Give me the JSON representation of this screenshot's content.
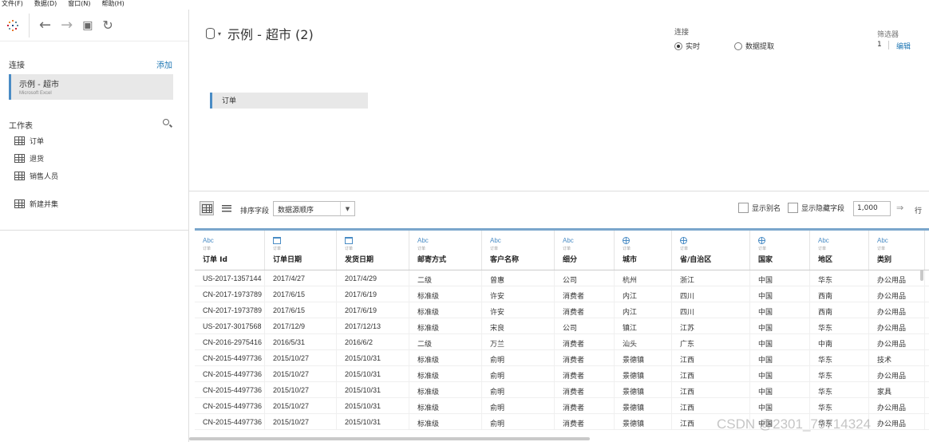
{
  "menu": [
    "文件(F)",
    "数据(D)",
    "窗口(N)",
    "帮助(H)"
  ],
  "left": {
    "connections_label": "连接",
    "add_label": "添加",
    "connection": {
      "name": "示例 - 超市",
      "type": "Microsoft Excel"
    },
    "sheets_label": "工作表",
    "sheets": [
      "订单",
      "退货",
      "销售人员"
    ],
    "new_union": "新建并集"
  },
  "header": {
    "datasource_title": "示例 - 超市 (2)",
    "connection_label": "连接",
    "live_label": "实时",
    "extract_label": "数据提取",
    "filter_label": "筛选器",
    "filter_count": "1",
    "filter_edit": "编辑"
  },
  "canvas": {
    "table": "订单"
  },
  "grid_toolbar": {
    "sort_label": "排序字段",
    "sort_value": "数据源顺序",
    "show_alias": "显示别名",
    "show_hidden": "显示隐藏字段",
    "rows_value": "1,000",
    "rows_unit": "行"
  },
  "grid": {
    "columns": [
      {
        "type": "Abc",
        "source": "订单",
        "name": "订单 Id",
        "icon": "text"
      },
      {
        "type": "",
        "source": "订单",
        "name": "订单日期",
        "icon": "calendar"
      },
      {
        "type": "",
        "source": "订单",
        "name": "发货日期",
        "icon": "calendar"
      },
      {
        "type": "Abc",
        "source": "订单",
        "name": "邮寄方式",
        "icon": "text"
      },
      {
        "type": "Abc",
        "source": "订单",
        "name": "客户名称",
        "icon": "text"
      },
      {
        "type": "Abc",
        "source": "订单",
        "name": "细分",
        "icon": "text"
      },
      {
        "type": "",
        "source": "订单",
        "name": "城市",
        "icon": "globe"
      },
      {
        "type": "",
        "source": "订单",
        "name": "省/自治区",
        "icon": "globe"
      },
      {
        "type": "",
        "source": "订单",
        "name": "国家",
        "icon": "globe"
      },
      {
        "type": "Abc",
        "source": "订单",
        "name": "地区",
        "icon": "text"
      },
      {
        "type": "Abc",
        "source": "订单",
        "name": "类别",
        "icon": "text"
      }
    ],
    "rows": [
      [
        "US-2017-1357144",
        "2017/4/27",
        "2017/4/29",
        "二级",
        "曾惠",
        "公司",
        "杭州",
        "浙江",
        "中国",
        "华东",
        "办公用品"
      ],
      [
        "CN-2017-1973789",
        "2017/6/15",
        "2017/6/19",
        "标准级",
        "许安",
        "消费者",
        "内江",
        "四川",
        "中国",
        "西南",
        "办公用品"
      ],
      [
        "CN-2017-1973789",
        "2017/6/15",
        "2017/6/19",
        "标准级",
        "许安",
        "消费者",
        "内江",
        "四川",
        "中国",
        "西南",
        "办公用品"
      ],
      [
        "US-2017-3017568",
        "2017/12/9",
        "2017/12/13",
        "标准级",
        "宋良",
        "公司",
        "镇江",
        "江苏",
        "中国",
        "华东",
        "办公用品"
      ],
      [
        "CN-2016-2975416",
        "2016/5/31",
        "2016/6/2",
        "二级",
        "万兰",
        "消费者",
        "汕头",
        "广东",
        "中国",
        "中南",
        "办公用品"
      ],
      [
        "CN-2015-4497736",
        "2015/10/27",
        "2015/10/31",
        "标准级",
        "俞明",
        "消费者",
        "景德镇",
        "江西",
        "中国",
        "华东",
        "技术"
      ],
      [
        "CN-2015-4497736",
        "2015/10/27",
        "2015/10/31",
        "标准级",
        "俞明",
        "消费者",
        "景德镇",
        "江西",
        "中国",
        "华东",
        "办公用品"
      ],
      [
        "CN-2015-4497736",
        "2015/10/27",
        "2015/10/31",
        "标准级",
        "俞明",
        "消费者",
        "景德镇",
        "江西",
        "中国",
        "华东",
        "家具"
      ],
      [
        "CN-2015-4497736",
        "2015/10/27",
        "2015/10/31",
        "标准级",
        "俞明",
        "消费者",
        "景德镇",
        "江西",
        "中国",
        "华东",
        "办公用品"
      ],
      [
        "CN-2015-4497736",
        "2015/10/27",
        "2015/10/31",
        "标准级",
        "俞明",
        "消费者",
        "景德镇",
        "江西",
        "中国",
        "华东",
        "办公用品"
      ]
    ]
  },
  "watermark": "CSDN @2301_79714324",
  "colors": {
    "accent": "#4a8cc5",
    "link": "#1f77b4"
  }
}
